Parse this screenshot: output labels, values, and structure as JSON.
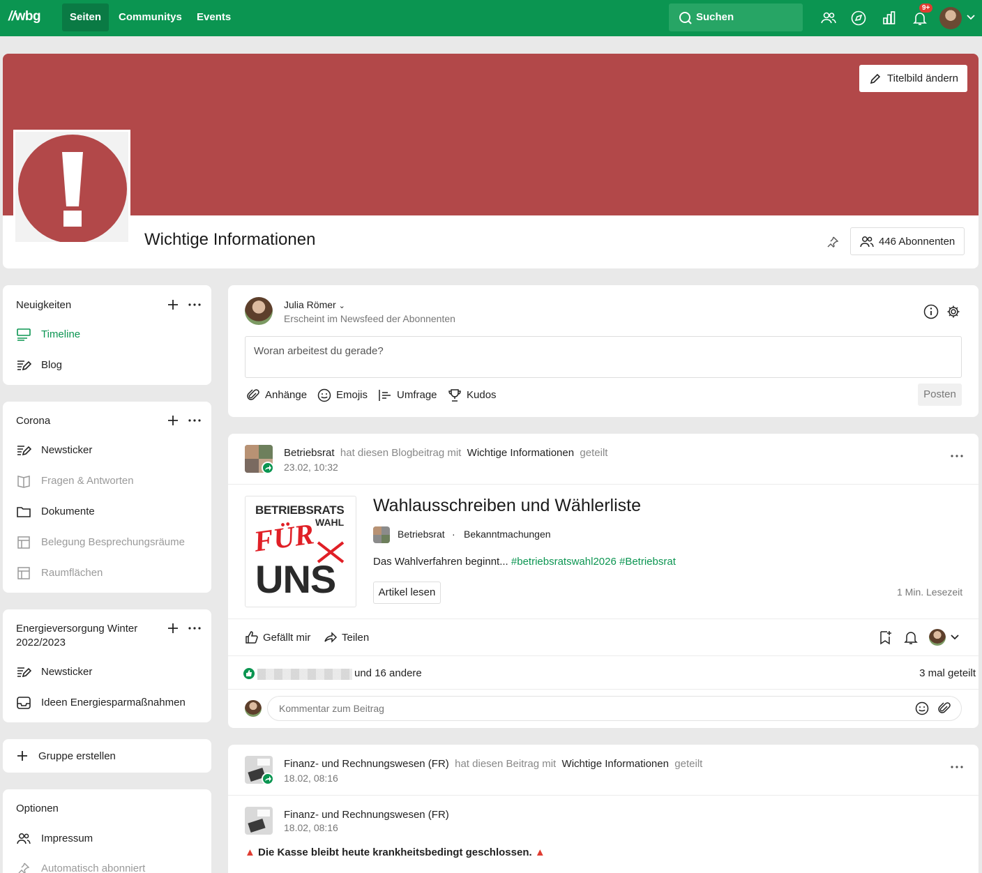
{
  "topbar": {
    "logo": "wbg",
    "nav": [
      "Seiten",
      "Communitys",
      "Events"
    ],
    "search_label": "Suchen",
    "notification_badge": "9+",
    "color": "#0b9551"
  },
  "header": {
    "cover_button": "Titelbild ändern",
    "title": "Wichtige Informationen",
    "subscribers_button": "446 Abonnenten",
    "cover_color": "#b24849"
  },
  "sidebar": {
    "news": {
      "title": "Neuigkeiten",
      "items": [
        "Timeline",
        "Blog"
      ]
    },
    "corona": {
      "title": "Corona",
      "items": [
        "Newsticker",
        "Fragen & Antworten",
        "Dokumente",
        "Belegung Besprechungsräume",
        "Raumflächen"
      ]
    },
    "energy": {
      "title_line1": "Energieversorgung Winter",
      "title_line2": "2022/2023",
      "items": [
        "Newsticker",
        "Ideen Energiesparmaßnahmen"
      ]
    },
    "create_group": "Gruppe erstellen",
    "options": {
      "title": "Optionen",
      "items": [
        "Impressum",
        "Automatisch abonniert"
      ]
    }
  },
  "composer": {
    "author": "Julia Römer",
    "audience": "Erscheint im Newsfeed der Abonnenten",
    "placeholder": "Woran arbeitest du gerade?",
    "tools": [
      "Anhänge",
      "Emojis",
      "Umfrage",
      "Kudos"
    ],
    "post_button": "Posten"
  },
  "post1": {
    "author": "Betriebsrat",
    "action": "hat diesen Blogbeitrag mit",
    "target": "Wichtige Informationen",
    "action_end": "geteilt",
    "time": "23.02, 10:32",
    "thumb_lines": [
      "BETRIEBSRATS",
      "WAHL",
      "FÜR",
      "UNS"
    ],
    "article_title": "Wahlausschreiben und Wählerliste",
    "article_author": "Betriebsrat",
    "separator": "·",
    "article_category": "Bekanntmachungen",
    "article_desc": "Das Wahlverfahren beginnt...",
    "tags": "#betriebsratswahl2026 #Betriebsrat",
    "read_button": "Artikel lesen",
    "read_time": "1 Min. Lesezeit",
    "like": "Gefällt mir",
    "share": "Teilen",
    "likes_text": "und 16 andere",
    "shares_text": "3 mal geteilt",
    "comment_placeholder": "Kommentar zum Beitrag"
  },
  "post2": {
    "author": "Finanz- und Rechnungswesen (FR)",
    "action": "hat diesen Beitrag mit",
    "target": "Wichtige Informationen",
    "action_end": "geteilt",
    "time": "18.02, 08:16",
    "inner_author": "Finanz- und Rechnungswesen (FR)",
    "inner_time": "18.02, 08:16",
    "announcement": "Die Kasse bleibt heute krankheitsbedingt geschlossen."
  }
}
